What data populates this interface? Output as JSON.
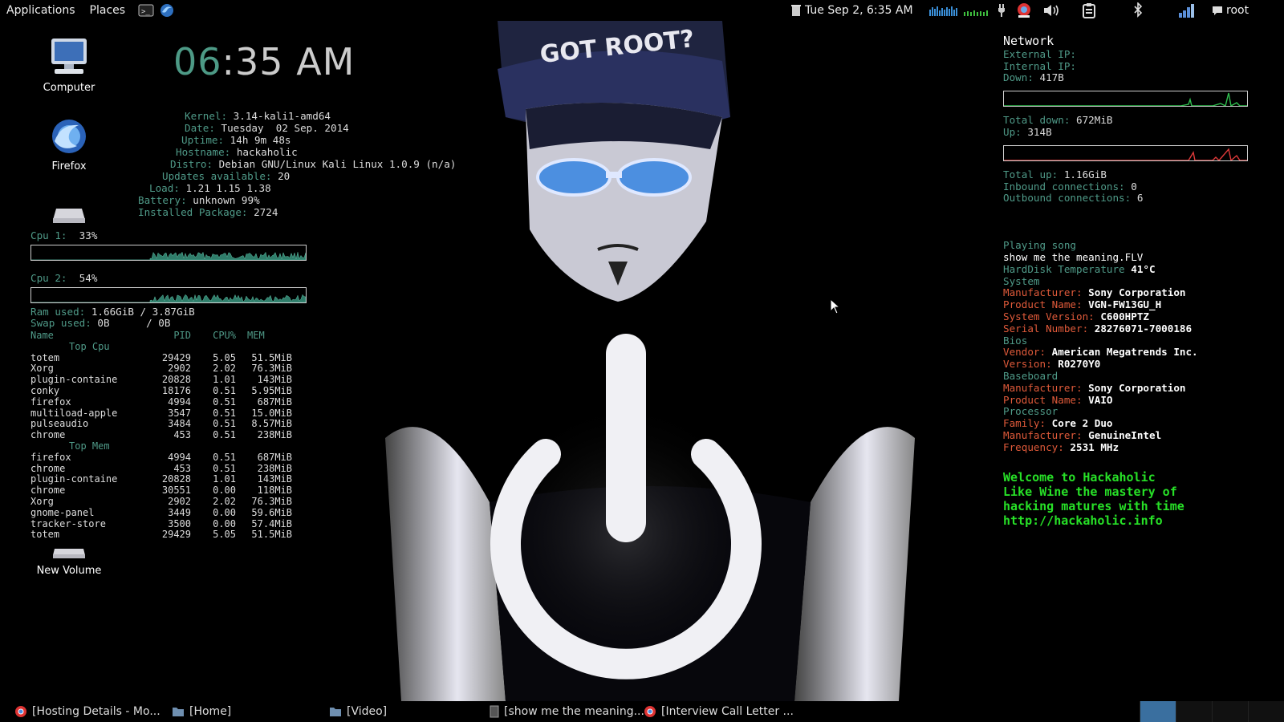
{
  "top_panel": {
    "applications": "Applications",
    "places": "Places",
    "datetime": "Tue Sep  2,  6:35 AM",
    "user": "root",
    "colors": {
      "accent": "#4f9a88"
    }
  },
  "desktop_icons": [
    {
      "label": "Computer",
      "icon": "computer-icon"
    },
    {
      "label": "Firefox",
      "icon": "firefox-icon"
    },
    {
      "label": "New Volume",
      "icon": "drive-icon"
    }
  ],
  "clock": {
    "hours": "06",
    "rest": ":35 AM"
  },
  "system": {
    "kernel_label": "Kernel:",
    "kernel": "3.14-kali1-amd64",
    "date_label": "Date:",
    "date": "Tuesday  02 Sep. 2014",
    "uptime_label": "Uptime:",
    "uptime": "14h 9m 48s",
    "hostname_label": "Hostname:",
    "hostname": "hackaholic",
    "distro_label": "Distro:",
    "distro": "Debian GNU/Linux Kali Linux 1.0.9 (n/a)",
    "updates_label": "Updates available:",
    "updates": "20",
    "load_label": "Load:",
    "load": "1.21 1.15 1.38",
    "battery_label": "Battery:",
    "battery": "unknown 99%",
    "packages_label": "Installed Package:",
    "packages": "2724"
  },
  "cpu": [
    {
      "label": "Cpu 1:",
      "value": "33%"
    },
    {
      "label": "Cpu 2:",
      "value": "54%"
    }
  ],
  "memory": {
    "ram_label": "Ram used:",
    "ram": "1.66GiB / 3.87GiB",
    "swap_label": "Swap used:",
    "swap": "0B      / 0B"
  },
  "processes": {
    "headers": [
      "Name",
      "PID",
      "CPU%",
      "MEM"
    ],
    "top_cpu_title": "Top Cpu",
    "top_cpu": [
      [
        "totem",
        "29429",
        "5.05",
        "51.5MiB"
      ],
      [
        "Xorg",
        "2902",
        "2.02",
        "76.3MiB"
      ],
      [
        "plugin-containe",
        "20828",
        "1.01",
        "143MiB"
      ],
      [
        "conky",
        "18176",
        "0.51",
        "5.95MiB"
      ],
      [
        "firefox",
        "4994",
        "0.51",
        "687MiB"
      ],
      [
        "multiload-apple",
        "3547",
        "0.51",
        "15.0MiB"
      ],
      [
        "pulseaudio",
        "3484",
        "0.51",
        "8.57MiB"
      ],
      [
        "chrome",
        "453",
        "0.51",
        "238MiB"
      ]
    ],
    "top_mem_title": "Top Mem",
    "top_mem": [
      [
        "firefox",
        "4994",
        "0.51",
        "687MiB"
      ],
      [
        "chrome",
        "453",
        "0.51",
        "238MiB"
      ],
      [
        "plugin-containe",
        "20828",
        "1.01",
        "143MiB"
      ],
      [
        "chrome",
        "30551",
        "0.00",
        "118MiB"
      ],
      [
        "Xorg",
        "2902",
        "2.02",
        "76.3MiB"
      ],
      [
        "gnome-panel",
        "3449",
        "0.00",
        "59.6MiB"
      ],
      [
        "tracker-store",
        "3500",
        "0.00",
        "57.4MiB"
      ],
      [
        "totem",
        "29429",
        "5.05",
        "51.5MiB"
      ]
    ]
  },
  "network": {
    "title": "Network",
    "external_ip_label": "External IP:",
    "internal_ip_label": "Internal IP:",
    "down_label": "Down:",
    "down": "417B",
    "total_down_label": "Total down:",
    "total_down": "672MiB",
    "up_label": "Up:",
    "up": "314B",
    "total_up_label": "Total up:",
    "total_up": "1.16GiB",
    "inbound_label": "Inbound connections:",
    "inbound": "0",
    "outbound_label": "Outbound connections:",
    "outbound": "6"
  },
  "media": {
    "playing_label": "Playing song",
    "song": "show me the meaning.FLV",
    "hdd_temp_label": "HardDisk Temperature",
    "hdd_temp": "41°C"
  },
  "hardware": {
    "system_title": "System",
    "manufacturer_label": "Manufacturer:",
    "manufacturer": "Sony Corporation",
    "product_label": "Product Name:",
    "product": "VGN-FW13GU_H",
    "sysver_label": "System Version:",
    "sysver": "C600HPTZ",
    "serial_label": "Serial Number:",
    "serial": "28276071-7000186",
    "bios_title": "Bios",
    "vendor_label": "Vendor:",
    "vendor": "American Megatrends Inc.",
    "version_label": "Version:",
    "version": "R0270Y0",
    "baseboard_title": "Baseboard",
    "bb_manufacturer_label": "Manufacturer:",
    "bb_manufacturer": "Sony Corporation",
    "bb_product_label": "Product Name:",
    "bb_product": "VAIO",
    "processor_title": "Processor",
    "family_label": "Family:",
    "family": "Core 2 Duo",
    "cpu_manufacturer_label": "Manufacturer:",
    "cpu_manufacturer": "GenuineIntel",
    "frequency_label": "Frequency:",
    "frequency": "2531 MHz"
  },
  "welcome": {
    "line1": "Welcome to Hackaholic",
    "line2": "Like Wine the mastery of",
    "line3": "hacking matures with time",
    "line4": "http://hackaholic.info"
  },
  "wallpaper": {
    "caption": "GOT ROOT?"
  },
  "taskbar": {
    "tasks": [
      {
        "label": "[Hosting Details - Mo...",
        "icon": "chrome-icon"
      },
      {
        "label": "[Home]",
        "icon": "folder-icon"
      },
      {
        "label": "[Video]",
        "icon": "folder-icon"
      },
      {
        "label": "[show me the meaning...",
        "icon": "media-file-icon"
      },
      {
        "label": "[Interview Call Letter ...",
        "icon": "chrome-icon"
      }
    ]
  }
}
